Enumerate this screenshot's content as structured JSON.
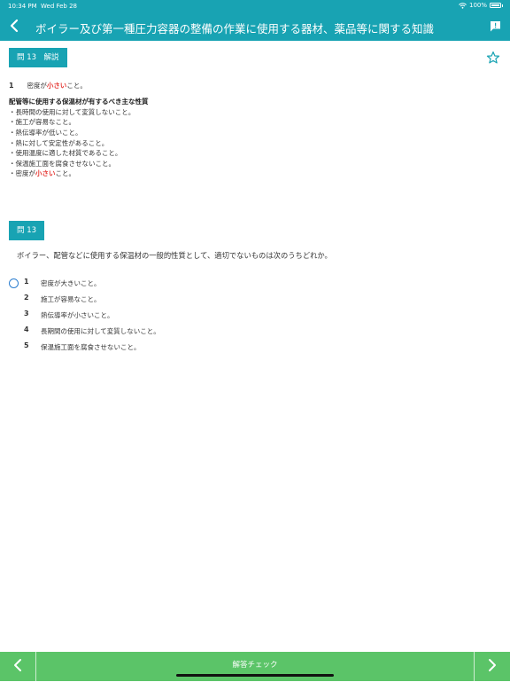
{
  "status": {
    "time": "10:34 PM",
    "date": "Wed Feb 28",
    "battery": "100%"
  },
  "nav": {
    "title": "ボイラー及び第一種圧力容器の整備の作業に使用する器材、薬品等に関する知識"
  },
  "explanation": {
    "chip": "問 13　解説",
    "answer_number": "1",
    "answer_pre": "密度が",
    "answer_hl": "小さい",
    "answer_post": "こと。",
    "heading": "配管等に使用する保温材が有するべき主な性質",
    "points": [
      "・長時間の使用に対して変質しないこと。",
      "・施工が容易なこと。",
      "・熱伝導率が低いこと。",
      "・熱に対して安定性があること。",
      "・使用温度に適した材質であること。",
      "・保温施工面を腐食させないこと。"
    ],
    "last_pre": "・密度が",
    "last_hl": "小さい",
    "last_post": "こと。"
  },
  "question": {
    "chip": "問 13",
    "text": "ボイラー、配管などに使用する保温材の一般的性質として、適切でないものは次のうちどれか。",
    "options": [
      {
        "num": "1",
        "text": "密度が大きいこと。"
      },
      {
        "num": "2",
        "text": "施工が容易なこと。"
      },
      {
        "num": "3",
        "text": "熱伝導率が小さいこと。"
      },
      {
        "num": "4",
        "text": "長期間の使用に対して変質しないこと。"
      },
      {
        "num": "5",
        "text": "保温施工面を腐食させないこと。"
      }
    ]
  },
  "footer": {
    "check_label": "解答チェック"
  },
  "colors": {
    "header": "#18a3b3",
    "footer": "#5bc468",
    "highlight": "#e53935",
    "radio": "#2d7fd0"
  }
}
